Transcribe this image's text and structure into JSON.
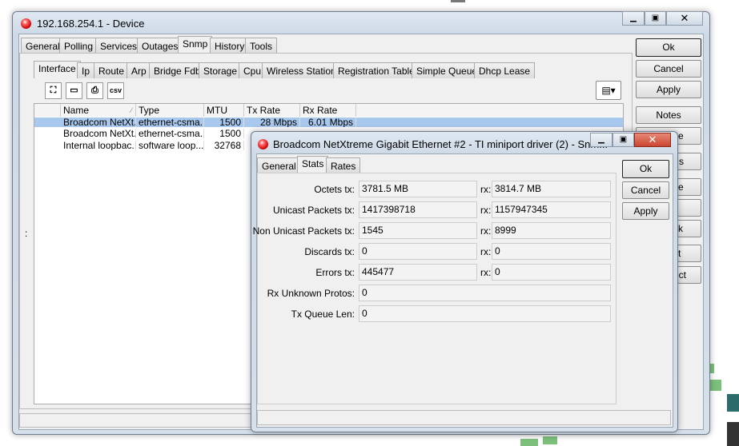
{
  "main_window": {
    "title": "192.168.254.1 - Device",
    "tabs": [
      "General",
      "Polling",
      "Services",
      "Outages",
      "Snmp",
      "History",
      "Tools"
    ],
    "selected_tab": "Snmp",
    "sub_tabs": [
      "Interface",
      "Ip",
      "Route",
      "Arp",
      "Bridge Fdb",
      "Storage",
      "Cpu",
      "Wireless Station",
      "Registration Table",
      "Simple Queue",
      "Dhcp Lease"
    ],
    "selected_sub_tab": "Interface",
    "toolbar": {
      "find_icon": "binoculars-icon",
      "window_icon": "window-icon",
      "print_icon": "printer-icon",
      "csv_label": "csv",
      "columns_icon": "columns-menu-icon"
    },
    "table": {
      "columns": [
        "Name",
        "Type",
        "MTU",
        "Tx Rate",
        "Rx Rate"
      ],
      "rows": [
        {
          "name": "Broadcom NetXt...",
          "type": "ethernet-csma...",
          "mtu": "1500",
          "tx": "28 Mbps",
          "rx": "6.01 Mbps"
        },
        {
          "name": "Broadcom NetXt...",
          "type": "ethernet-csma...",
          "mtu": "1500",
          "tx": "",
          "rx": ""
        },
        {
          "name": "Internal loopbac...",
          "type": "software loop...",
          "mtu": "32768",
          "tx": "",
          "rx": ""
        }
      ]
    },
    "side_marker": ":",
    "buttons": {
      "ok": "Ok",
      "cancel": "Cancel",
      "apply": "Apply",
      "notes": "Notes",
      "b5": "e",
      "b6": "s",
      "b7": "e",
      "b8": "",
      "b9": "k",
      "b10": "t",
      "b11": "ect"
    }
  },
  "dialog": {
    "title": "Broadcom NetXtreme Gigabit Ethernet #2 - TI miniport driver  (2) - Snm...",
    "tabs": [
      "General",
      "Stats",
      "Rates"
    ],
    "selected_tab": "Stats",
    "stats": [
      {
        "label": "Octets tx:",
        "tx": "3781.5 MB",
        "rx_label": "rx:",
        "rx": "3814.7 MB"
      },
      {
        "label": "Unicast Packets tx:",
        "tx": "1417398718",
        "rx_label": "rx:",
        "rx": "1157947345"
      },
      {
        "label": "Non Unicast Packets tx:",
        "tx": "1545",
        "rx_label": "rx:",
        "rx": "8999"
      },
      {
        "label": "Discards tx:",
        "tx": "0",
        "rx_label": "rx:",
        "rx": "0"
      },
      {
        "label": "Errors tx:",
        "tx": "445477",
        "rx_label": "rx:",
        "rx": "0"
      },
      {
        "label": "Rx Unknown Protos:",
        "value": "0"
      },
      {
        "label": "Tx Queue Len:",
        "value": "0"
      }
    ],
    "buttons": {
      "ok": "Ok",
      "cancel": "Cancel",
      "apply": "Apply"
    }
  },
  "colors": {
    "selection": "#a8c8ee",
    "close_red": "#c9452f"
  }
}
